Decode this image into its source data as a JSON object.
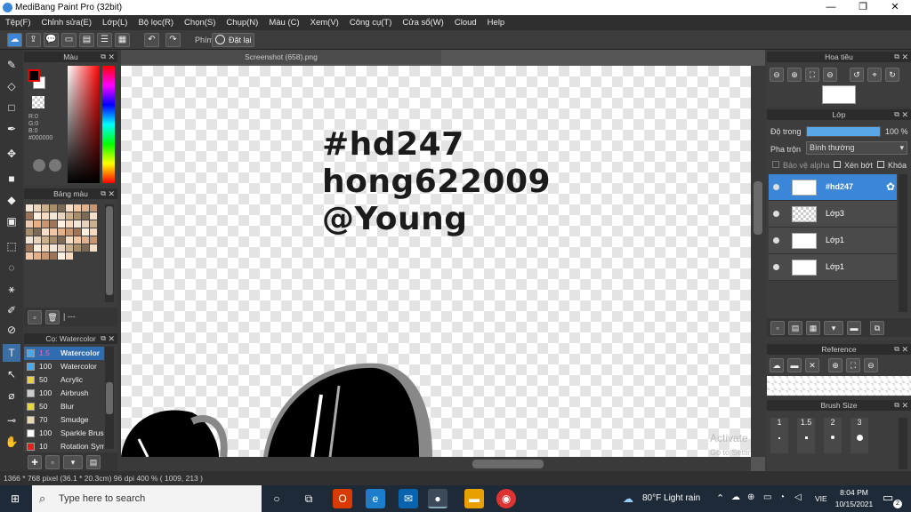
{
  "window": {
    "title": "MediBang Paint Pro (32bit)",
    "minimize": "—",
    "maximize": "❐",
    "close": "✕"
  },
  "menu": [
    "Tệp(F)",
    "Chỉnh sửa(E)",
    "Lớp(L)",
    "Bộ lọc(R)",
    "Chọn(S)",
    "Chụp(N)",
    "Màu (C)",
    "Xem(V)",
    "Công cụ(T)",
    "Cửa sổ(W)",
    "Cloud",
    "Help"
  ],
  "toolbar": {
    "shortcut_label": "Phím",
    "reset_label": "Đặt lại"
  },
  "color_panel": {
    "title": "Màu",
    "r": "R:0",
    "g": "G:0",
    "b": "B:0",
    "hex": "#000000"
  },
  "palette_panel": {
    "title": "Bảng màu",
    "footer": "| ---"
  },
  "brush_panel": {
    "title": "Cọ: Watercolor",
    "items": [
      {
        "size": "1.5",
        "name": "Watercolor",
        "color": "#4aa8e8"
      },
      {
        "size": "100",
        "name": "Watercolor",
        "color": "#4aa8e8"
      },
      {
        "size": "50",
        "name": "Acrylic",
        "color": "#e6d23a"
      },
      {
        "size": "100",
        "name": "Airbrush",
        "color": "#cccccc"
      },
      {
        "size": "50",
        "name": "Blur",
        "color": "#e8d840"
      },
      {
        "size": "70",
        "name": "Smudge",
        "color": "#e8d8b0"
      },
      {
        "size": "100",
        "name": "Sparkle Brush",
        "color": "#ffffff"
      },
      {
        "size": "10",
        "name": "Rotation Sym",
        "color": "#e02020"
      }
    ]
  },
  "document": {
    "tab": "Screenshot (658).png",
    "line1": "#hd247",
    "line2": "hong622009",
    "line3": "@Young"
  },
  "navigator": {
    "title": "Hoa tiêu"
  },
  "layer_panel": {
    "title": "Lớp",
    "opacity_label": "Độ trong",
    "opacity_value": "100 %",
    "opacity": 1.0,
    "blend_label": "Pha trộn",
    "blend_value": "Bình thường",
    "protect_alpha": "Bảo vệ alpha",
    "clipping": "Xén bớt",
    "lock": "Khóa",
    "layers": [
      {
        "name": "#hd247",
        "selected": true
      },
      {
        "name": "Lớp3",
        "selected": false
      },
      {
        "name": "Lớp1",
        "selected": false
      },
      {
        "name": "Lớp1",
        "selected": false
      }
    ]
  },
  "reference_panel": {
    "title": "Reference"
  },
  "brush_size_panel": {
    "title": "Brush Size",
    "sizes": [
      "1",
      "1.5",
      "2",
      "3"
    ]
  },
  "watermark": {
    "line1": "Activate Windows",
    "line2": "Go to Settings to activate Windows."
  },
  "status_bar": {
    "text": "1366 * 768 pixel   (36.1 * 20.3cm)   96 dpi   400 %   ( 1009, 213 )"
  },
  "taskbar": {
    "search_placeholder": "Type here to search",
    "weather": "80°F  Light rain",
    "lang": "VIE",
    "time": "8:04 PM",
    "date": "10/15/2021",
    "notif_count": "2"
  }
}
